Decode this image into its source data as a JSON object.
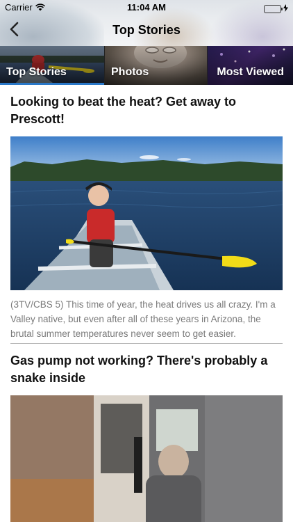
{
  "status_bar": {
    "carrier": "Carrier",
    "time": "11:04 AM"
  },
  "nav": {
    "title": "Top Stories",
    "back_icon": "chevron-left-icon"
  },
  "tabs": [
    {
      "label": "Top Stories",
      "selected": true
    },
    {
      "label": "Photos",
      "selected": false
    },
    {
      "label": "Most Viewed",
      "selected": false
    }
  ],
  "articles": [
    {
      "title": "Looking to beat the heat? Get away to Prescott!",
      "summary": "(3TV/CBS 5) This time of year, the heat drives us all crazy. I'm a Valley native, but even after all of these years in Arizona, the brutal summer temperatures never seem to get easier."
    },
    {
      "title": "Gas pump not working? There's probably a snake inside"
    }
  ],
  "colors": {
    "accent": "#2a78c8",
    "battery": "#4cd964",
    "summary_text": "#7a7a7a"
  }
}
